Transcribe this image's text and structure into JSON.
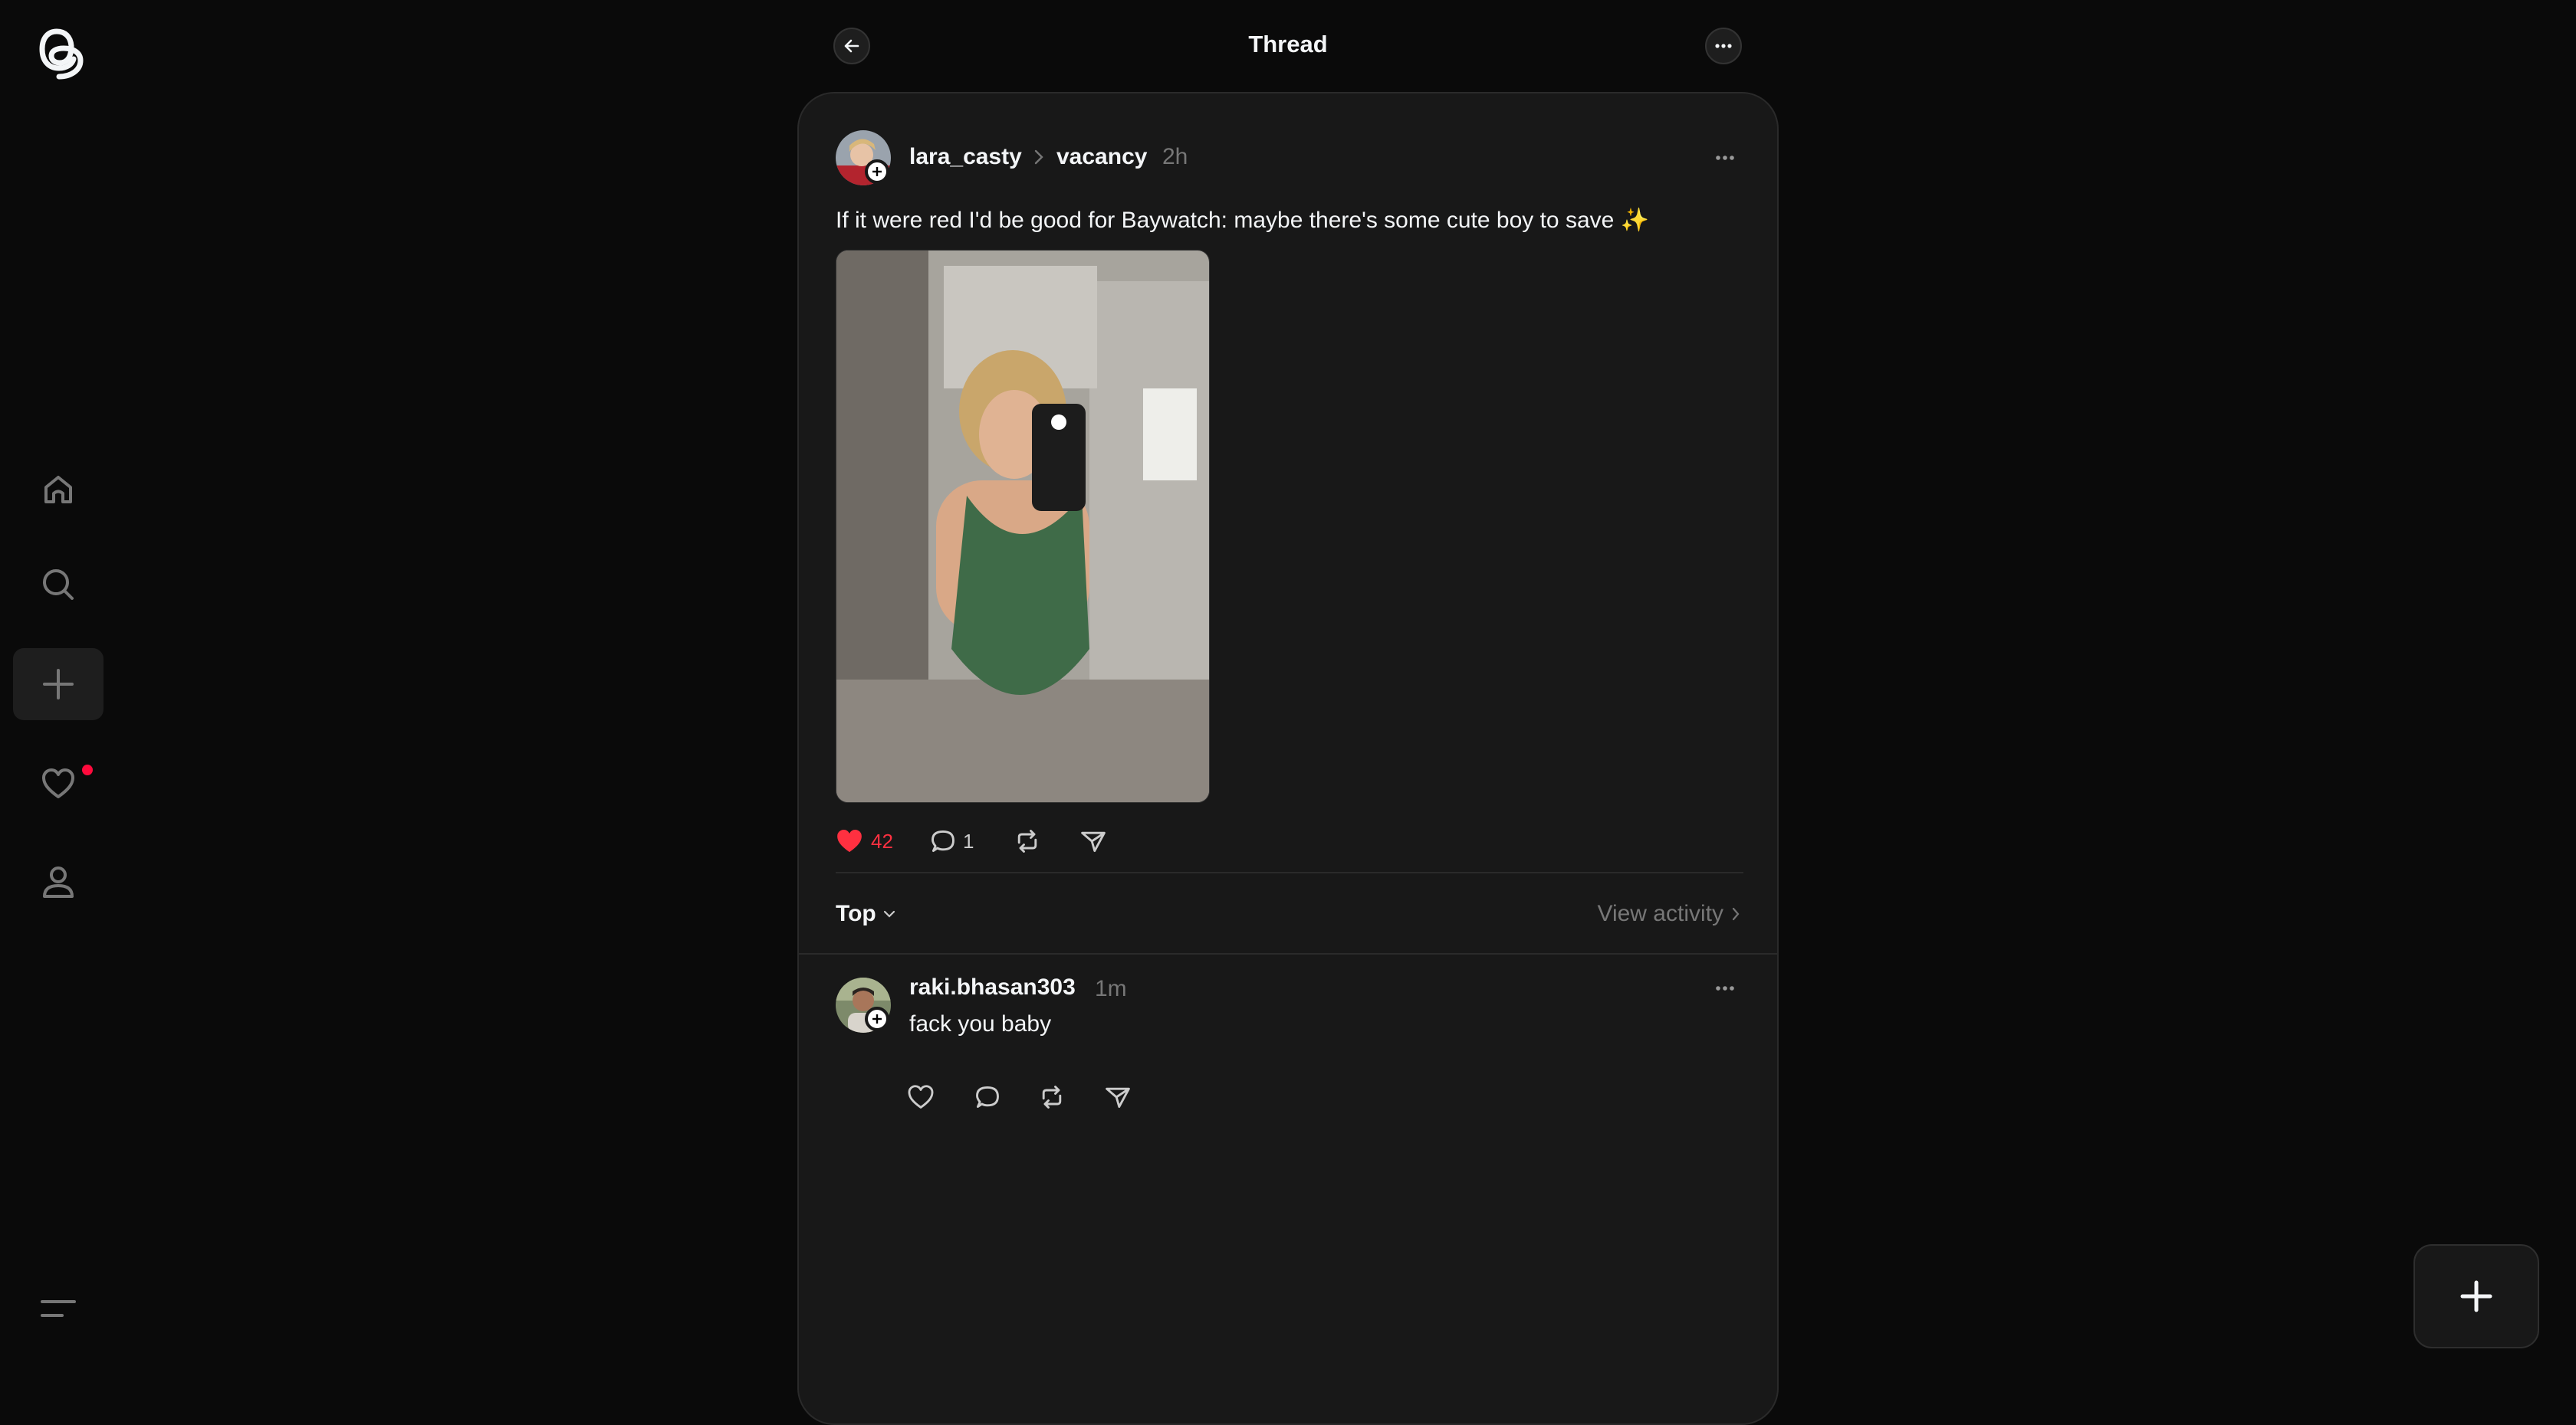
{
  "header": {
    "title": "Thread"
  },
  "post": {
    "username": "lara_casty",
    "topic": "vacancy",
    "time": "2h",
    "text": "If it were red I'd be good for Baywatch: maybe there's some cute boy to save ✨",
    "likes": "42",
    "replies": "1",
    "liked": true
  },
  "sort": {
    "label": "Top",
    "view_activity": "View activity"
  },
  "reply": {
    "username": "raki.bhasan303",
    "time": "1m",
    "text": "fack you baby"
  },
  "colors": {
    "background": "#0a0a0a",
    "card": "#181818",
    "like": "#ff3040",
    "notification_dot": "#ff0a3c"
  },
  "icons": {
    "rail": [
      "threads-logo-icon",
      "home-icon",
      "search-icon",
      "plus-icon",
      "heart-icon",
      "profile-icon",
      "menu-icon"
    ],
    "actions": [
      "heart-icon",
      "comment-icon",
      "repost-icon",
      "share-icon"
    ]
  }
}
